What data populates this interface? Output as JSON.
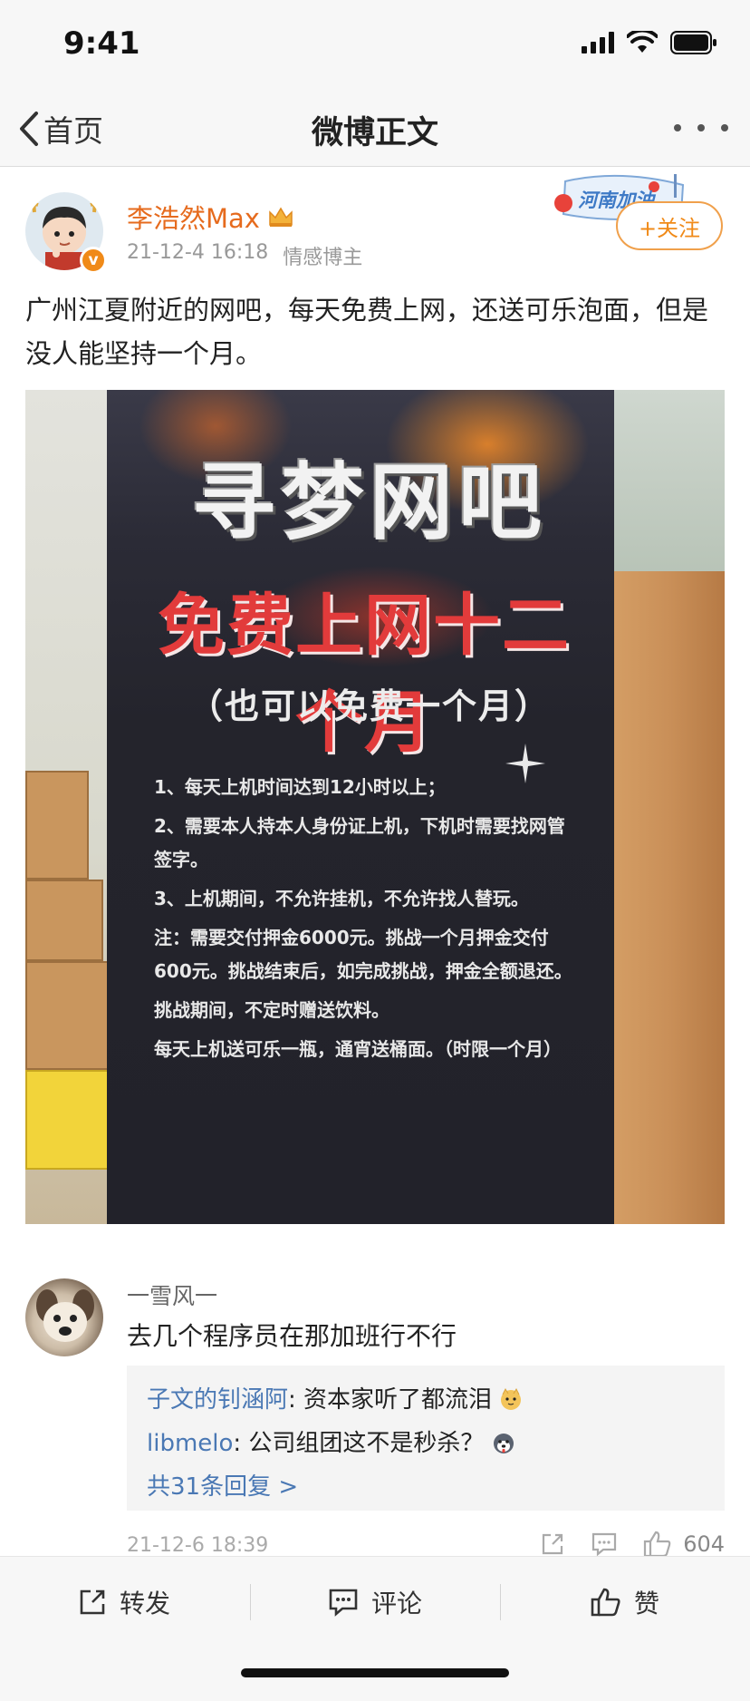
{
  "status_bar": {
    "time": "9:41"
  },
  "nav": {
    "back_label": "首页",
    "title": "微博正文"
  },
  "post": {
    "author": "李浩然Max",
    "time": "21-12-4 16:18",
    "tag": "情感博主",
    "follow_label": "+关注",
    "badge_text": "河南加油",
    "text": "广州江夏附近的网吧，每天免费上网，还送可乐泡面，但是没人能坚持一个月。",
    "image": {
      "title": "寻梦网吧",
      "subtitle": "免费上网十二个月",
      "paren": "（也可以免费一个月）",
      "rules": [
        "1、每天上机时间达到12小时以上；",
        "2、需要本人持本人身份证上机，下机时需要找网管签字。",
        "3、上机期间，不允许挂机，不允许找人替玩。",
        "注：需要交付押金6000元。挑战一个月押金交付600元。挑战结束后，如完成挑战，押金全额退还。",
        "挑战期间，不定时赠送饮料。",
        "每天上机送可乐一瓶，通宵送桶面。（时限一个月）"
      ]
    }
  },
  "comment": {
    "author": "一雪风一",
    "text": "去几个程序员在那加班行不行",
    "replies": [
      {
        "name": "子文的钊涵阿",
        "text": ": 资本家听了都流泪"
      },
      {
        "name": "libmelo",
        "text": ": 公司组团这不是秒杀？"
      }
    ],
    "more_replies": "共31条回复 >",
    "time": "21-12-6 18:39",
    "likes": "604"
  },
  "toolbar": {
    "repost": "转发",
    "comment": "评论",
    "like": "赞"
  },
  "colors": {
    "accent": "#f08a18",
    "author": "#e66b1e",
    "link": "#4a78b4"
  }
}
